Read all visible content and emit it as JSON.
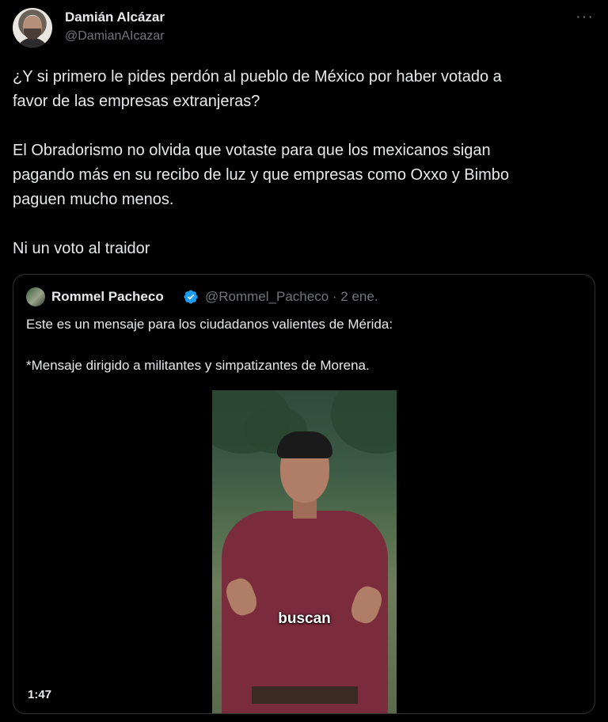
{
  "author": {
    "name": "Damián Alcázar",
    "handle": "@DamianAIcazar"
  },
  "more_label": "···",
  "tweet": {
    "paragraphs": [
      "¿Y si primero le pides perdón al pueblo de México por haber votado a\nfavor de las empresas extranjeras?",
      "El Obradorismo no olvida que votaste para que los mexicanos sigan\npagando más en su recibo de luz y que empresas como Oxxo y Bimbo\npaguen mucho menos.",
      "Ni un voto al traidor"
    ]
  },
  "quoted": {
    "name": "Rommel Pacheco",
    "meta": "@Rommel_Pacheco · 2 ene.",
    "paragraphs": [
      "Este es un mensaje para los ciudadanos valientes de Mérida:",
      "*Mensaje dirigido a militantes y simpatizantes de Morena."
    ],
    "video": {
      "caption": "buscan",
      "duration": "1:47"
    }
  },
  "colors": {
    "background": "#000000",
    "text": "#e7e9ea",
    "muted": "#71767b",
    "border": "#2f3336",
    "verified": "#1d9bf0"
  }
}
